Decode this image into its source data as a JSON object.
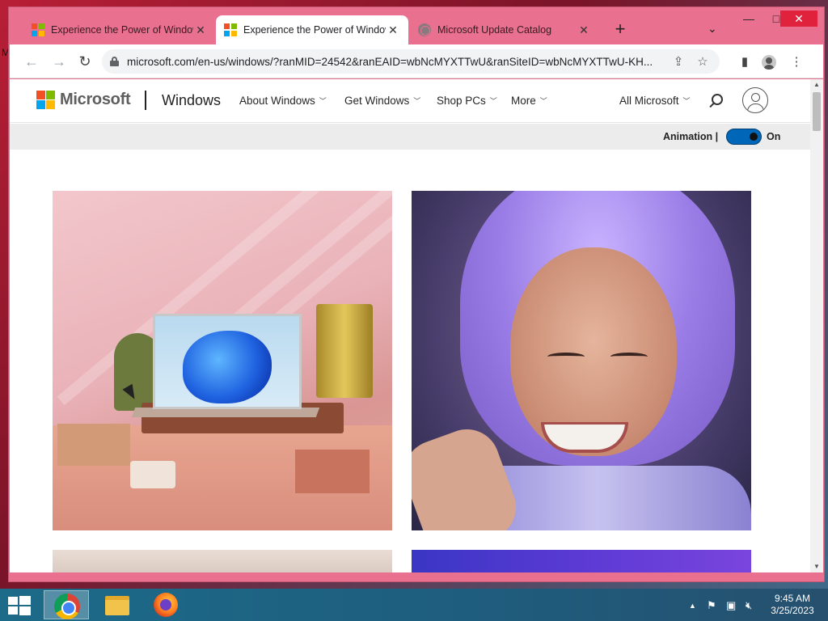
{
  "desktop": {
    "edge_text": "M"
  },
  "browser": {
    "tabs": [
      {
        "title": "Experience the Power of Windows",
        "icon": "microsoft-logo",
        "active": false
      },
      {
        "title": "Experience the Power of Windows",
        "icon": "microsoft-logo",
        "active": true
      },
      {
        "title": "Microsoft Update Catalog",
        "icon": "globe-icon",
        "active": false
      }
    ],
    "new_tab_symbol": "+",
    "window_controls": {
      "minimize": "—",
      "maximize": "□",
      "close": "✕"
    },
    "url": "microsoft.com/en-us/windows/?ranMID=24542&ranEAID=wbNcMYXTTwU&ranSiteID=wbNcMYXTTwU-KH..."
  },
  "site": {
    "brand": "Microsoft",
    "product": "Windows",
    "nav": [
      "About Windows",
      "Get Windows",
      "Shop PCs",
      "More"
    ],
    "all_microsoft": "All Microsoft",
    "animation_label": "Animation |",
    "animation_state": "On",
    "animation_on": true
  },
  "brand_colors": {
    "red": "#f25022",
    "green": "#7fba00",
    "blue": "#00a4ef",
    "yellow": "#ffb900",
    "accent": "#0067b8"
  },
  "taskbar": {
    "apps": [
      "chrome",
      "file-explorer",
      "firefox"
    ],
    "clock_time": "9:45 AM",
    "clock_date": "3/25/2023"
  }
}
